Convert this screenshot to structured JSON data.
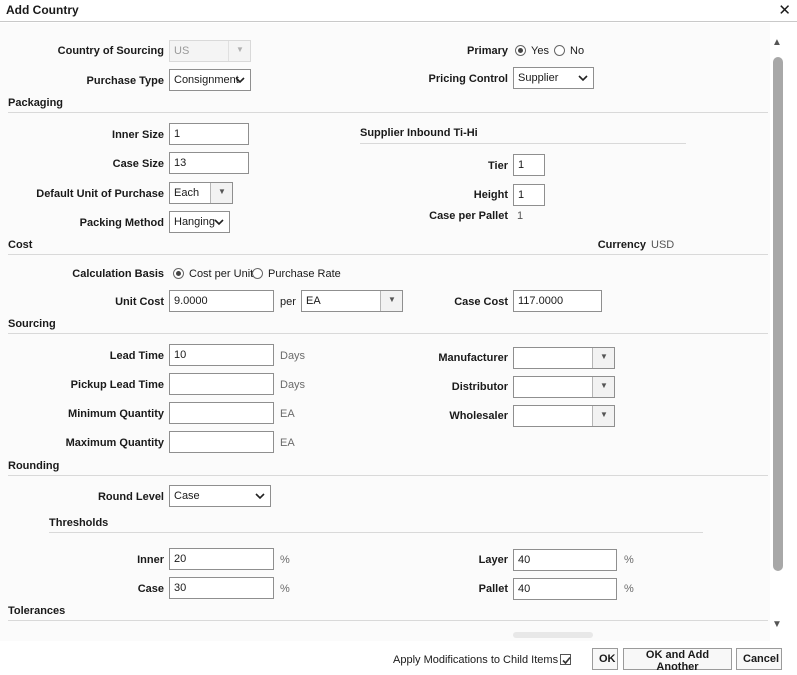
{
  "dialog": {
    "title": "Add Country"
  },
  "header": {
    "country_of_sourcing_label": "Country of Sourcing",
    "country_of_sourcing_value": "US",
    "primary_label": "Primary",
    "primary_yes": "Yes",
    "primary_no": "No",
    "purchase_type_label": "Purchase Type",
    "purchase_type_value": "Consignment",
    "pricing_control_label": "Pricing Control",
    "pricing_control_value": "Supplier"
  },
  "packaging": {
    "title": "Packaging",
    "inner_size_label": "Inner Size",
    "inner_size_value": "1",
    "case_size_label": "Case Size",
    "case_size_value": "13",
    "default_uop_label": "Default Unit of Purchase",
    "default_uop_value": "Each",
    "packing_method_label": "Packing Method",
    "packing_method_value": "Hanging",
    "tihi_title": "Supplier Inbound Ti-Hi",
    "tier_label": "Tier",
    "tier_value": "1",
    "height_label": "Height",
    "height_value": "1",
    "case_per_pallet_label": "Case per Pallet",
    "case_per_pallet_value": "1"
  },
  "cost": {
    "title": "Cost",
    "currency_label": "Currency",
    "currency_value": "USD",
    "calc_basis_label": "Calculation Basis",
    "calc_cost_per_unit": "Cost per Unit",
    "calc_purchase_rate": "Purchase Rate",
    "unit_cost_label": "Unit Cost",
    "unit_cost_value": "9.0000",
    "per_label": "per",
    "per_value": "EA",
    "case_cost_label": "Case Cost",
    "case_cost_value": "117.0000"
  },
  "sourcing": {
    "title": "Sourcing",
    "lead_time_label": "Lead Time",
    "lead_time_value": "10",
    "lead_time_unit": "Days",
    "pickup_lead_time_label": "Pickup Lead Time",
    "pickup_lead_time_value": "",
    "pickup_lead_time_unit": "Days",
    "min_qty_label": "Minimum Quantity",
    "min_qty_value": "",
    "min_qty_unit": "EA",
    "max_qty_label": "Maximum Quantity",
    "max_qty_value": "",
    "max_qty_unit": "EA",
    "manufacturer_label": "Manufacturer",
    "distributor_label": "Distributor",
    "wholesaler_label": "Wholesaler"
  },
  "rounding": {
    "title": "Rounding",
    "round_level_label": "Round Level",
    "round_level_value": "Case",
    "thresholds_title": "Thresholds",
    "inner_label": "Inner",
    "inner_value": "20",
    "case_label": "Case",
    "case_value": "30",
    "layer_label": "Layer",
    "layer_value": "40",
    "pallet_label": "Pallet",
    "pallet_value": "40",
    "pct": "%"
  },
  "tolerances": {
    "title": "Tolerances"
  },
  "footer": {
    "apply_mods_label": "Apply Modifications to Child Items",
    "ok": "OK",
    "ok_add_another": "OK and Add Another",
    "cancel": "Cancel"
  }
}
